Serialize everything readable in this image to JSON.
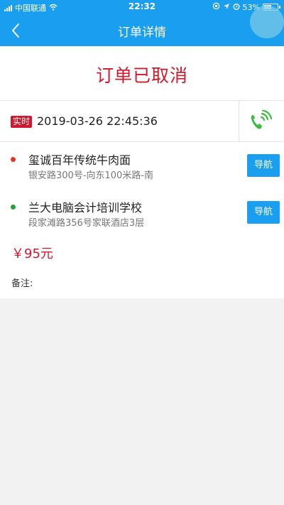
{
  "status_bar": {
    "carrier": "中国联通",
    "time": "22:32",
    "battery": "53%",
    "battery_level": 0.53
  },
  "header": {
    "title": "订单详情"
  },
  "order": {
    "status": "订单已取消",
    "type_badge": "实时",
    "datetime": "2019-03-26 22:45:36"
  },
  "addresses": [
    {
      "name": "玺诚百年传统牛肉面",
      "detail": "银安路300号-向东100米路-南",
      "nav_label": "导航",
      "dot_color": "#e8331c"
    },
    {
      "name": "兰大电脑会计培训学校",
      "detail": "段家滩路356号家联酒店3层",
      "nav_label": "导航",
      "dot_color": "#22a33a"
    }
  ],
  "price": "￥95元",
  "remark_label": "备注:"
}
